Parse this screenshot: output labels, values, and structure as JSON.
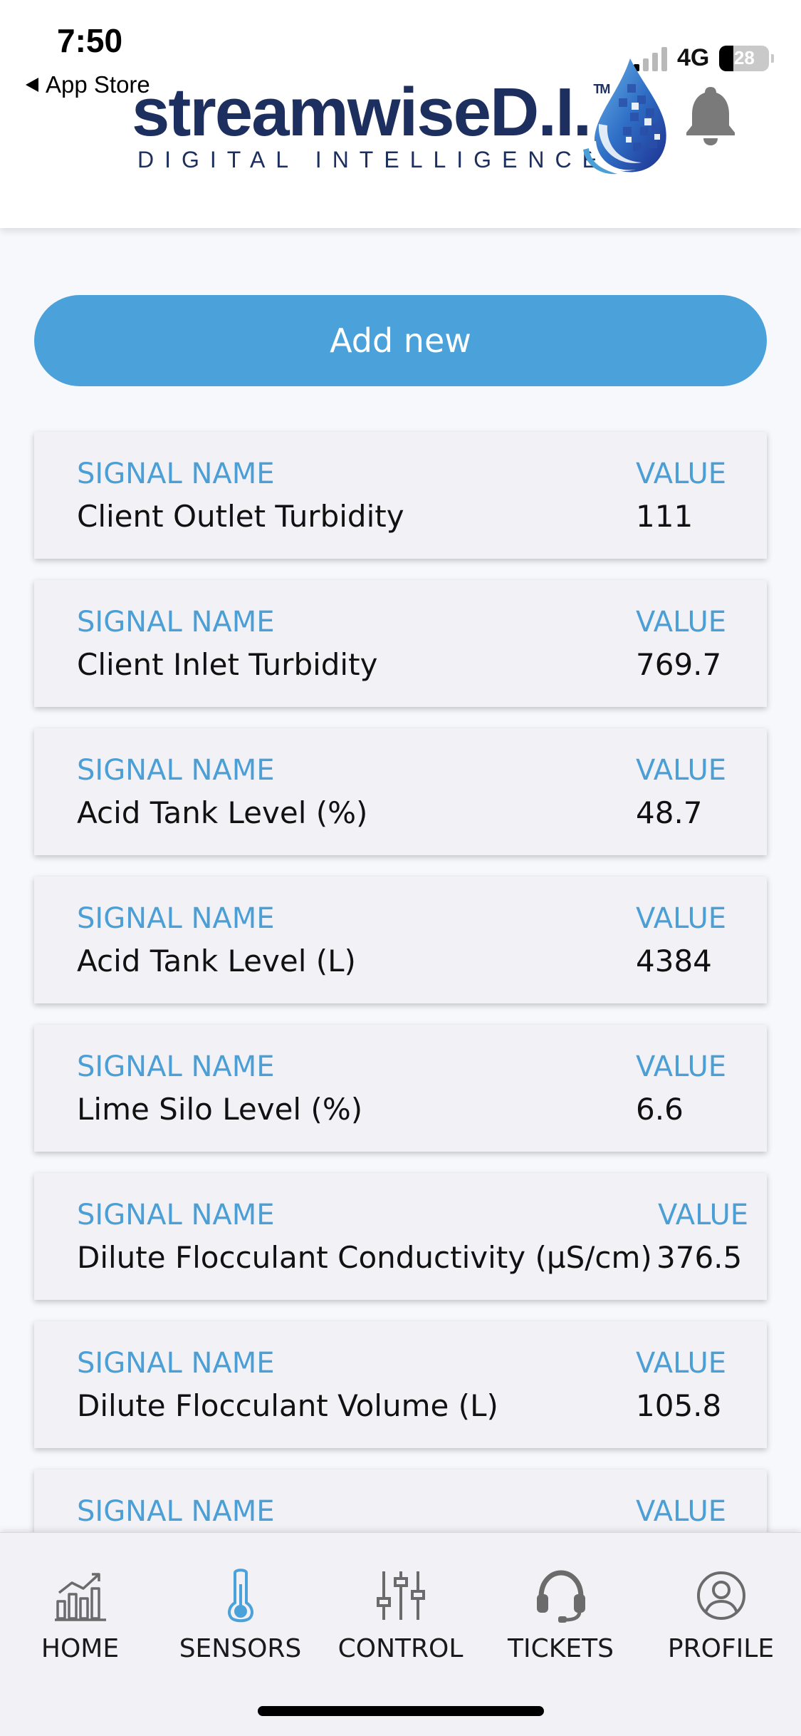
{
  "status_bar": {
    "time": "7:50",
    "back_label": "App Store",
    "network": "4G",
    "battery": "28"
  },
  "header": {
    "logo_word": "streamwiseD.I.",
    "logo_tagline": "DIGITAL INTELLIGENCE",
    "trademark": "TM",
    "colors": {
      "logo_navy": "#1d2f5e",
      "logo_blue": "#4a9fd6"
    }
  },
  "actions": {
    "add_new_label": "Add new"
  },
  "signals": [
    {
      "name_label": "SIGNAL NAME",
      "value_label": "VALUE",
      "name": "Client Outlet Turbidity",
      "value": "111"
    },
    {
      "name_label": "SIGNAL NAME",
      "value_label": "VALUE",
      "name": "Client Inlet Turbidity",
      "value": "769.7"
    },
    {
      "name_label": "SIGNAL NAME",
      "value_label": "VALUE",
      "name": "Acid Tank Level (%)",
      "value": "48.7"
    },
    {
      "name_label": "SIGNAL NAME",
      "value_label": "VALUE",
      "name": "Acid Tank Level (L)",
      "value": "4384"
    },
    {
      "name_label": "SIGNAL NAME",
      "value_label": "VALUE",
      "name": "Lime Silo Level (%)",
      "value": "6.6"
    },
    {
      "name_label": "SIGNAL NAME",
      "value_label": "VALUE",
      "name": "Dilute Flocculant Conductivity (µS/cm)",
      "value": "376.5"
    },
    {
      "name_label": "SIGNAL NAME",
      "value_label": "VALUE",
      "name": "Dilute Flocculant Volume (L)",
      "value": "105.8"
    },
    {
      "name_label": "SIGNAL NAME",
      "value_label": "VALUE",
      "name": "",
      "value": ""
    }
  ],
  "tabs": [
    {
      "label": "HOME",
      "icon": "chart-icon"
    },
    {
      "label": "SENSORS",
      "icon": "thermometer-icon",
      "active": true
    },
    {
      "label": "CONTROL",
      "icon": "sliders-icon"
    },
    {
      "label": "TICKETS",
      "icon": "headset-icon"
    },
    {
      "label": "PROFILE",
      "icon": "user-icon"
    }
  ],
  "colors": {
    "accent": "#4ba1da",
    "label_blue": "#4a9fd6",
    "card_bg": "#f2f1f6",
    "icon_gray": "#6b6b6b"
  }
}
